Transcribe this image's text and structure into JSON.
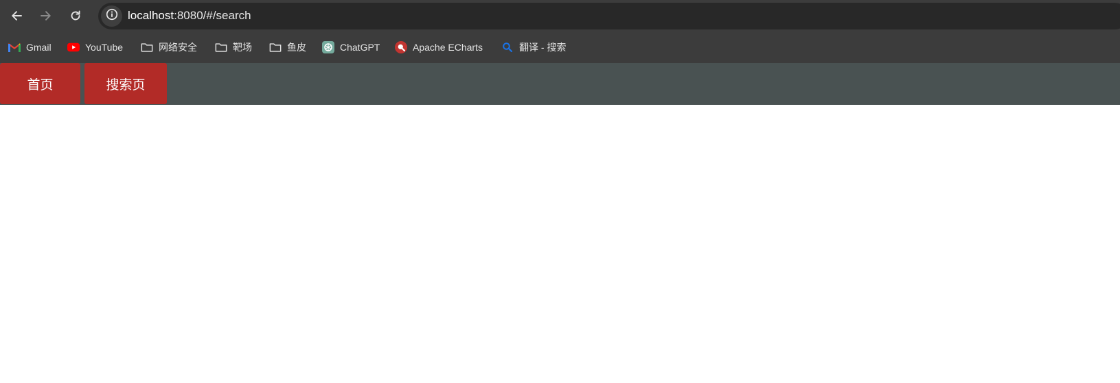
{
  "browser": {
    "url_host": "localhost",
    "url_rest": ":8080/#/search",
    "nav_icons": [
      "back-arrow-icon",
      "forward-arrow-icon",
      "reload-icon",
      "site-info-icon"
    ]
  },
  "bookmarks": [
    {
      "label": "Gmail",
      "icon": "gmail-icon"
    },
    {
      "label": "YouTube",
      "icon": "youtube-icon"
    },
    {
      "label": "网络安全",
      "icon": "folder-icon"
    },
    {
      "label": "靶场",
      "icon": "folder-icon"
    },
    {
      "label": "鱼皮",
      "icon": "folder-icon"
    },
    {
      "label": "ChatGPT",
      "icon": "chatgpt-icon"
    },
    {
      "label": "Apache ECharts",
      "icon": "echarts-icon"
    },
    {
      "label": "翻译 - 搜索",
      "icon": "search-icon"
    }
  ],
  "app_nav": {
    "tabs": [
      {
        "label": "首页"
      },
      {
        "label": "搜索页"
      }
    ],
    "colors": {
      "bar_bg": "#495252",
      "tab_bg": "#b22b27",
      "tab_text": "#ffffff"
    }
  }
}
